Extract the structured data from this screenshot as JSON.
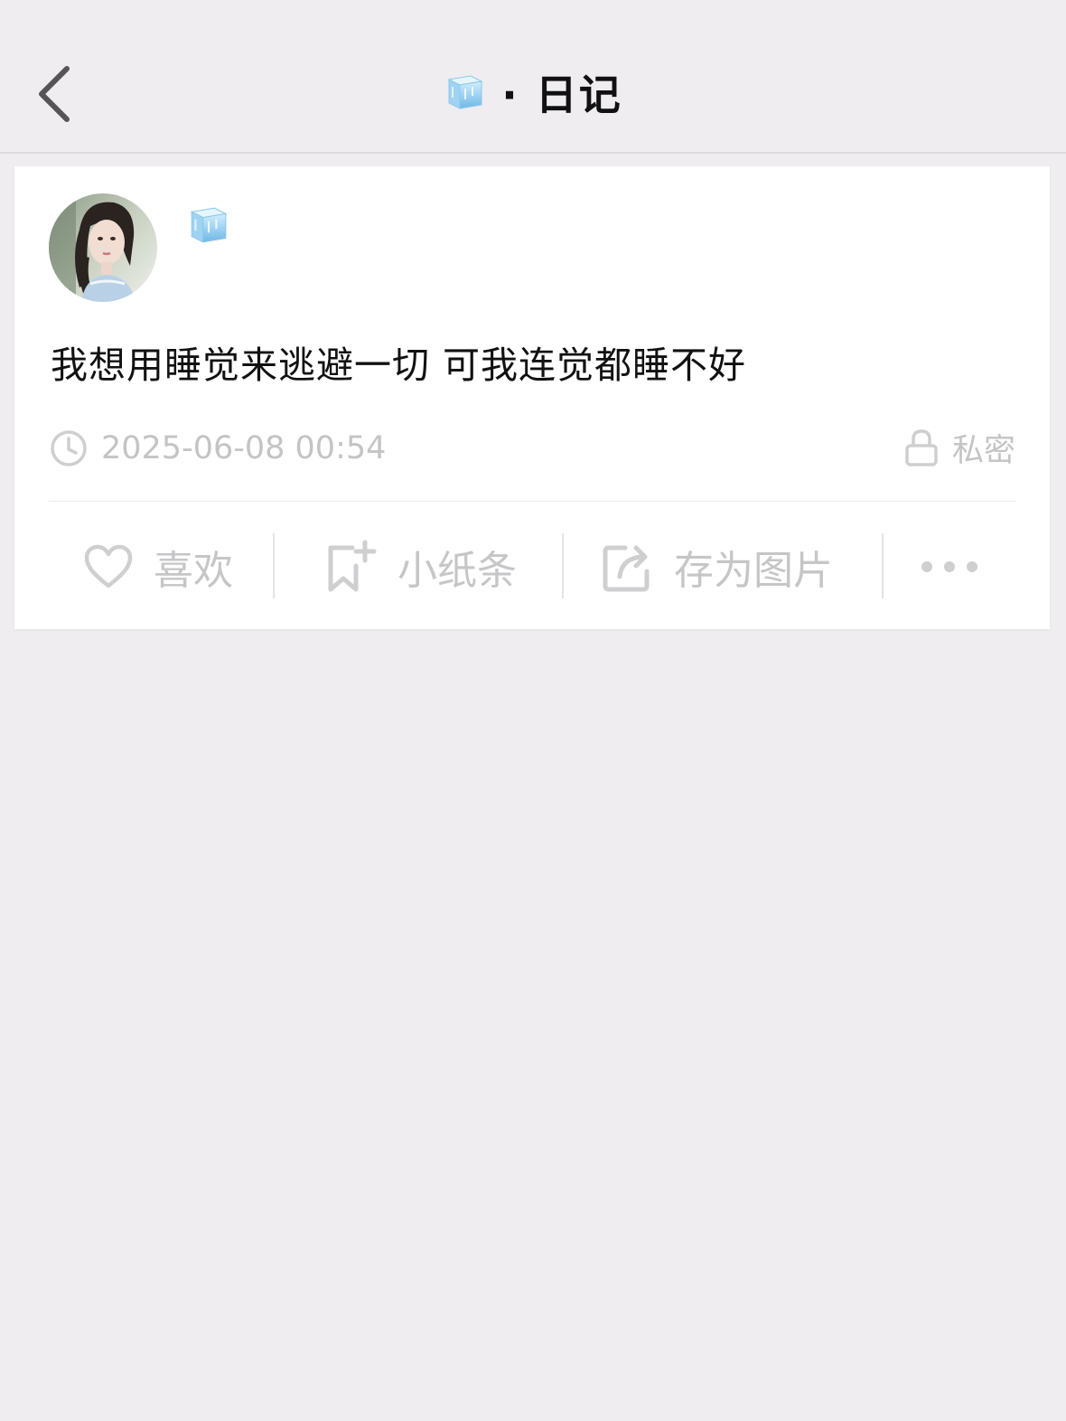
{
  "header": {
    "back_icon": "chevron-left-icon",
    "title_icon": "ice-cube-emoji",
    "title": "· 日记"
  },
  "post": {
    "author_avatar": "avatar-photo",
    "author_name_icon": "ice-cube-emoji",
    "content": "我想用睡觉来逃避一切 可我连觉都睡不好",
    "timestamp": "2025-06-08 00:54",
    "privacy_label": "私密"
  },
  "actions": [
    {
      "icon": "heart-icon",
      "label": "喜欢"
    },
    {
      "icon": "bookmark-plus-icon",
      "label": "小纸条"
    },
    {
      "icon": "share-icon",
      "label": "存为图片"
    },
    {
      "icon": "more-icon",
      "label": ""
    }
  ],
  "colors": {
    "background": "#efedf0",
    "card": "#ffffff",
    "muted_text": "#c4c4c6",
    "ice": "#9fd3f2"
  }
}
